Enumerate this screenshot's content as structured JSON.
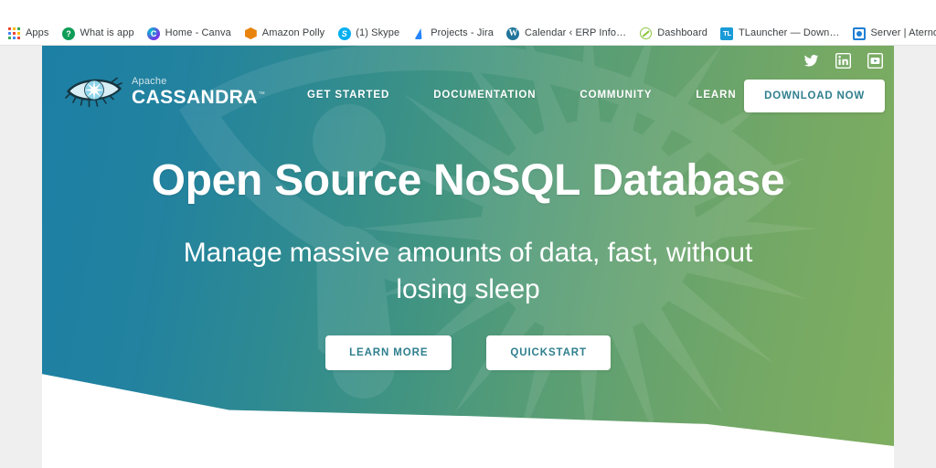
{
  "browser": {
    "bookmarks": [
      {
        "label": "Apps",
        "icon": "apps-grid-icon"
      },
      {
        "label": "What is app",
        "icon": "question-circle-icon"
      },
      {
        "label": "Home - Canva",
        "icon": "canva-icon"
      },
      {
        "label": "Amazon Polly",
        "icon": "amazon-polly-icon"
      },
      {
        "label": "(1) Skype",
        "icon": "skype-icon"
      },
      {
        "label": "Projects - Jira",
        "icon": "jira-icon"
      },
      {
        "label": "Calendar ‹ ERP Info…",
        "icon": "wordpress-icon"
      },
      {
        "label": "Dashboard",
        "icon": "dashboard-ring-icon"
      },
      {
        "label": "TLauncher — Down…",
        "icon": "tlauncher-icon"
      },
      {
        "label": "Server | Aternos | Fr…",
        "icon": "aternos-icon"
      }
    ]
  },
  "site": {
    "logo": {
      "apache": "Apache",
      "name": "CASSANDRA",
      "tm": "™"
    },
    "nav": [
      {
        "label": "GET STARTED"
      },
      {
        "label": "DOCUMENTATION"
      },
      {
        "label": "COMMUNITY"
      },
      {
        "label": "LEARN"
      }
    ],
    "socials": [
      {
        "name": "twitter-icon"
      },
      {
        "name": "linkedin-icon"
      },
      {
        "name": "youtube-icon"
      }
    ],
    "download_label": "DOWNLOAD NOW",
    "hero": {
      "title": "Open Source NoSQL Database",
      "subtitle": "Manage massive amounts of data, fast, without losing sleep",
      "cta_primary": "LEARN MORE",
      "cta_secondary": "QUICKSTART"
    }
  },
  "colors": {
    "hero_gradient_start": "#1c7fa5",
    "hero_gradient_end": "#7fae60",
    "button_text": "#2f7f8e",
    "button_bg": "#ffffff",
    "page_bg": "#efefef",
    "bookmark_text": "#3c4043"
  }
}
